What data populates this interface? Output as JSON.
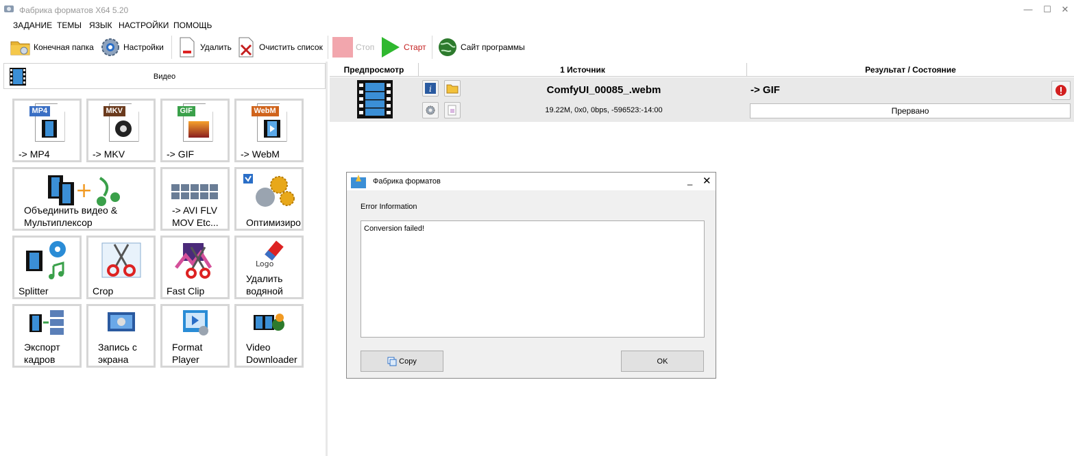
{
  "window": {
    "title": "Фабрика форматов X64 5.20",
    "minimize": "—",
    "maximize": "☐",
    "close": "✕"
  },
  "menu": [
    "ЗАДАНИЕ",
    "ТЕМЫ",
    "ЯЗЫК",
    "НАСТРОЙКИ",
    "ПОМОЩЬ"
  ],
  "toolbar": {
    "output_folder": "Конечная папка",
    "settings": "Настройки",
    "remove": "Удалить",
    "clear_list": "Очистить список",
    "stop": "Стоп",
    "start": "Старт",
    "website": "Сайт программы"
  },
  "category": {
    "label": "Видео"
  },
  "tiles": [
    {
      "label": "-> MP4",
      "tag": "MP4",
      "tag_color": "#3a6fc4"
    },
    {
      "label": "-> MKV",
      "tag": "MKV",
      "tag_color": "#6b3b1e"
    },
    {
      "label": "-> GIF",
      "tag": "GIF",
      "tag_color": "#3aa04a"
    },
    {
      "label": "-> WebM",
      "tag": "WebM",
      "tag_color": "#d0641c"
    },
    {
      "label": "Объединить видео &\nМультиплексор"
    },
    {
      "label": "-> AVI FLV\nMOV Etc..."
    },
    {
      "label": "Оптимизиро"
    },
    {
      "label": "Splitter"
    },
    {
      "label": "Crop"
    },
    {
      "label": "Fast Clip"
    },
    {
      "label": "Удалить\nводяной",
      "logo_text": "Logo"
    },
    {
      "label": "Экспорт\nкадров"
    },
    {
      "label": "Запись с\nэкрана"
    },
    {
      "label": "Format\nPlayer"
    },
    {
      "label": "Video\nDownloader"
    }
  ],
  "table": {
    "headers": [
      "Предпросмотр",
      "1 Источник",
      "Результат / Состояние"
    ],
    "row": {
      "filename": "ComfyUI_00085_.webm",
      "info": "19.22M, 0x0, 0bps, -596523:-14:00",
      "target": "-> GIF",
      "status": "Прервано"
    }
  },
  "dialog": {
    "title": "Фабрика форматов",
    "minimize": "_",
    "close": "✕",
    "label": "Error Information",
    "message": "Conversion failed!",
    "copy": "Copy",
    "ok": "OK"
  },
  "colors": {
    "start_green": "#2fb82f",
    "stop_pink": "#f2a6ad",
    "error_red": "#d21f1f"
  }
}
